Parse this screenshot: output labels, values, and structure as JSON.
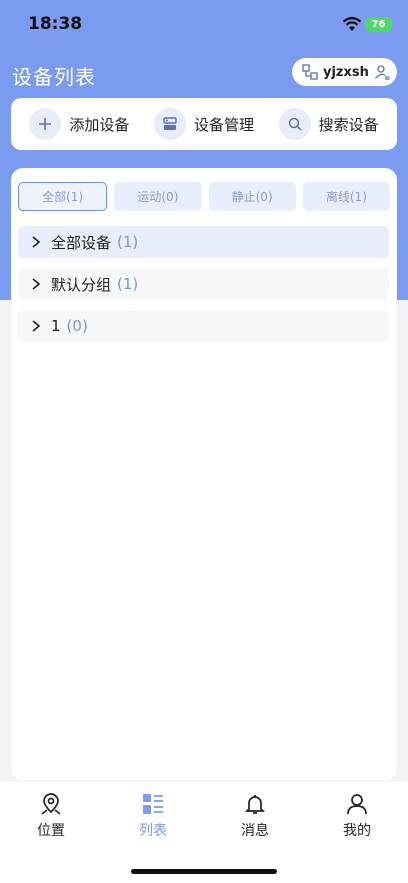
{
  "status_bar": {
    "time": "18:38",
    "battery": "76"
  },
  "header": {
    "title": "设备列表",
    "account_name": "yjzxsh"
  },
  "actions": [
    {
      "label": "添加设备",
      "icon": "plus-icon"
    },
    {
      "label": "设备管理",
      "icon": "manage-icon"
    },
    {
      "label": "搜索设备",
      "icon": "search-icon"
    }
  ],
  "filters": [
    {
      "label": "全部(1)",
      "active": true
    },
    {
      "label": "运动(0)",
      "active": false
    },
    {
      "label": "静止(0)",
      "active": false
    },
    {
      "label": "离线(1)",
      "active": false
    }
  ],
  "groups": [
    {
      "name": "全部设备",
      "count": "(1)"
    },
    {
      "name": "默认分组",
      "count": "(1)"
    },
    {
      "name": "1",
      "count": "(0)"
    }
  ],
  "tabbar": [
    {
      "label": "位置",
      "icon": "location-icon"
    },
    {
      "label": "列表",
      "icon": "list-icon",
      "active": true
    },
    {
      "label": "消息",
      "icon": "bell-icon"
    },
    {
      "label": "我的",
      "icon": "user-icon"
    }
  ],
  "colors": {
    "accent": "#7b9bf1",
    "count": "#7c95d6",
    "tab_bg": "#e9eefc"
  }
}
